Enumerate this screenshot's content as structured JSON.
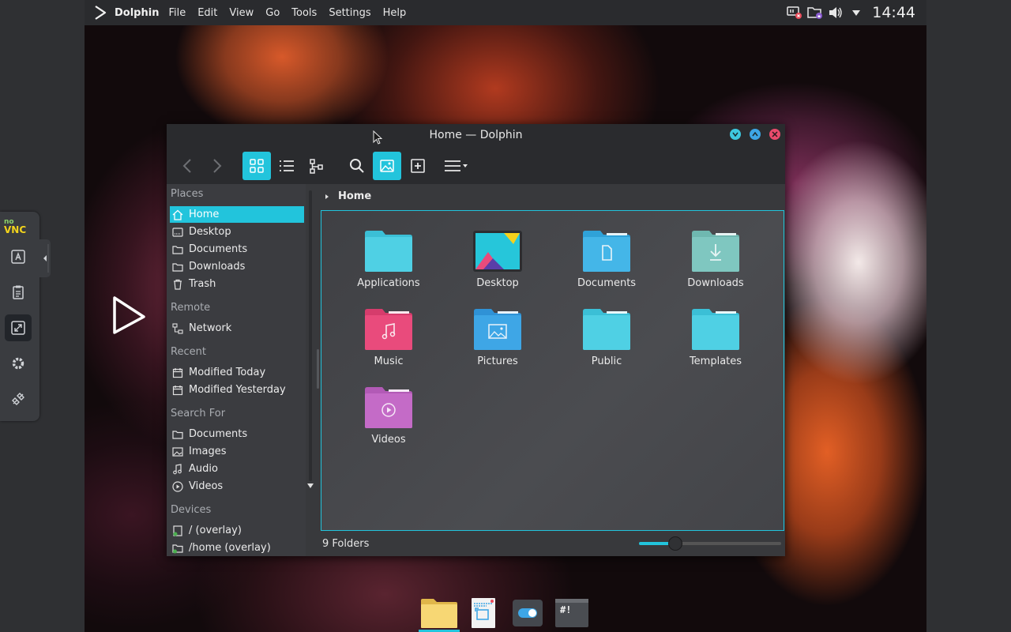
{
  "topbar": {
    "app_name": "Dolphin",
    "menus": [
      "File",
      "Edit",
      "View",
      "Go",
      "Tools",
      "Settings",
      "Help"
    ],
    "clock": "14:44"
  },
  "window": {
    "title": "Home — Dolphin",
    "breadcrumb": "Home",
    "status": "9 Folders",
    "zoom_fraction": 0.25
  },
  "places": {
    "sections": {
      "places": "Places",
      "remote": "Remote",
      "recent": "Recent",
      "search": "Search For",
      "devices": "Devices"
    },
    "items": {
      "home": "Home",
      "desktop": "Desktop",
      "documents": "Documents",
      "downloads": "Downloads",
      "trash": "Trash",
      "network": "Network",
      "modified_today": "Modified Today",
      "modified_yesterday": "Modified Yesterday",
      "search_documents": "Documents",
      "search_images": "Images",
      "search_audio": "Audio",
      "search_videos": "Videos",
      "root": "/ (overlay)",
      "home_overlay": "/home (overlay)"
    }
  },
  "folders": [
    {
      "label": "Applications"
    },
    {
      "label": "Desktop"
    },
    {
      "label": "Documents"
    },
    {
      "label": "Downloads"
    },
    {
      "label": "Music"
    },
    {
      "label": "Pictures"
    },
    {
      "label": "Public"
    },
    {
      "label": "Templates"
    },
    {
      "label": "Videos"
    }
  ],
  "novnc": {
    "logo_top": "no",
    "logo_bottom": "VNC"
  },
  "terminal_glyph": "#!",
  "colors": {
    "accent": "#22c4dc",
    "folder": "#4fcfe2",
    "music": "#e94b7c",
    "pictures": "#3ea6e6",
    "downloads": "#7fc7c0",
    "videos": "#c46bc7"
  }
}
